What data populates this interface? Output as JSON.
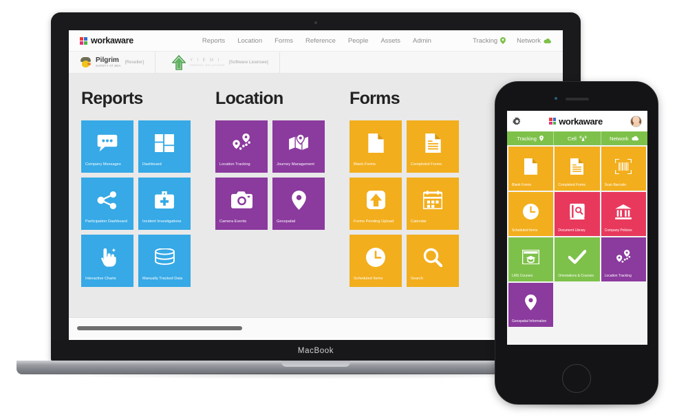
{
  "desktop": {
    "device_label": "MacBook",
    "brand": {
      "name": "workaware",
      "colors": [
        "#ee3b33",
        "#2f6fd0",
        "#e1337f",
        "#49b649"
      ]
    },
    "nav": [
      {
        "label": "Reports"
      },
      {
        "label": "Location"
      },
      {
        "label": "Forms"
      },
      {
        "label": "Reference"
      },
      {
        "label": "People"
      },
      {
        "label": "Assets"
      },
      {
        "label": "Admin"
      }
    ],
    "status": [
      {
        "label": "Tracking",
        "icon": "map-pin-icon",
        "color": "#7ec14a"
      },
      {
        "label": "Network",
        "icon": "cloud-icon",
        "color": "#7ec14a"
      }
    ],
    "subbar": {
      "reseller_name": "Pilgrim",
      "reseller_subtitle": "SAFETY AT SEA",
      "reseller_tag": "[Reseller]",
      "licensee_name": "Y I E M I",
      "licensee_subtitle": "ENERGY SOLUTIONS",
      "licensee_tag": "[Software Licensee]"
    },
    "groups": [
      {
        "title": "Reports",
        "color": "#36a9e6",
        "tiles": [
          {
            "label": "Company Messages",
            "icon": "chat-bubble-icon"
          },
          {
            "label": "Dashboard",
            "icon": "dashboard-grid-icon"
          },
          {
            "label": "Participation Dashboard",
            "icon": "share-network-icon"
          },
          {
            "label": "Incident Investigations",
            "icon": "first-aid-kit-icon"
          },
          {
            "label": "Interactive Charts",
            "icon": "pointer-hand-icon"
          },
          {
            "label": "Manually Tracked Data",
            "icon": "database-icon"
          }
        ]
      },
      {
        "title": "Location",
        "color": "#8b3a9e",
        "tiles": [
          {
            "label": "Location Tracking",
            "icon": "route-pins-icon"
          },
          {
            "label": "Journey Management",
            "icon": "folded-map-icon"
          },
          {
            "label": "Camera Events",
            "icon": "camera-icon"
          },
          {
            "label": "Geospatial",
            "icon": "map-pin-icon"
          }
        ]
      },
      {
        "title": "Forms",
        "color": "#f2ae1c",
        "tiles": [
          {
            "label": "Blank Forms",
            "icon": "blank-document-icon"
          },
          {
            "label": "Completed Forms",
            "icon": "lined-document-icon"
          },
          {
            "label": "Forms Pending Upload",
            "icon": "upload-arrow-icon"
          },
          {
            "label": "Calendar",
            "icon": "calendar-icon"
          },
          {
            "label": "Scheduled Items",
            "icon": "clock-icon"
          },
          {
            "label": "Search",
            "icon": "magnifier-icon"
          }
        ]
      }
    ]
  },
  "phone": {
    "settings_icon": "gear-icon",
    "brand": {
      "name": "workaware",
      "colors": [
        "#ee3b33",
        "#2f6fd0",
        "#e1337f",
        "#49b649"
      ]
    },
    "avatar": "user-avatar",
    "status": [
      {
        "label": "Tracking",
        "icon": "map-pin-icon"
      },
      {
        "label": "Cell",
        "icon": "signal-bars-icon"
      },
      {
        "label": "Network",
        "icon": "cloud-icon"
      }
    ],
    "status_bar_color": "#7ec14a",
    "tiles": [
      {
        "label": "Blank Forms",
        "icon": "blank-document-icon",
        "color": "#f2ae1c"
      },
      {
        "label": "Completed Forms",
        "icon": "lined-document-icon",
        "color": "#f2ae1c"
      },
      {
        "label": "Scan Barcode",
        "icon": "barcode-scan-icon",
        "color": "#f2ae1c"
      },
      {
        "label": "Scheduled Items",
        "icon": "clock-icon",
        "color": "#f2ae1c"
      },
      {
        "label": "Document Library",
        "icon": "book-search-icon",
        "color": "#e8395c"
      },
      {
        "label": "Company Policies",
        "icon": "bank-building-icon",
        "color": "#e8395c"
      },
      {
        "label": "LMS Courses",
        "icon": "graduation-board-icon",
        "color": "#7ec14a"
      },
      {
        "label": "Orientations & Courses",
        "icon": "checkmark-icon",
        "color": "#7ec14a"
      },
      {
        "label": "Location Tracking",
        "icon": "route-pins-icon",
        "color": "#8b3a9e"
      },
      {
        "label": "Geospatial Information",
        "icon": "map-pin-icon",
        "color": "#8b3a9e"
      }
    ]
  }
}
